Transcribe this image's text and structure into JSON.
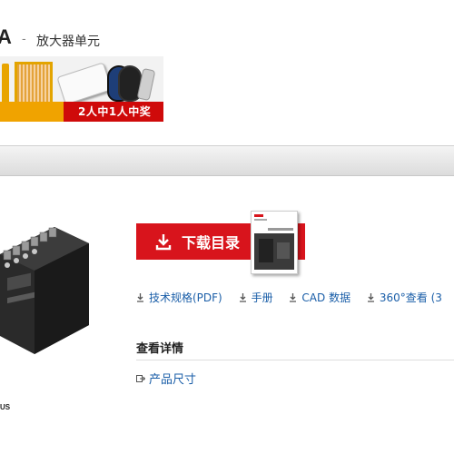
{
  "header": {
    "model_fragment": "A",
    "separator": "-",
    "subtitle": "放大器单元"
  },
  "banner": {
    "promo_text": "2人中1人中奖"
  },
  "product": {
    "caption": "US"
  },
  "actions": {
    "download_label": "下载目录"
  },
  "links": [
    {
      "label": "技术规格(PDF)",
      "icon": "download-icon"
    },
    {
      "label": "手册",
      "icon": "download-icon"
    },
    {
      "label": "CAD 数据",
      "icon": "download-icon"
    },
    {
      "label": "360°查看 (3",
      "icon": "download-icon"
    }
  ],
  "details": {
    "heading": "查看详情",
    "dimensions_link": "产品尺寸"
  },
  "colors": {
    "accent_red": "#d8141c",
    "link_blue": "#1a5ea8"
  }
}
